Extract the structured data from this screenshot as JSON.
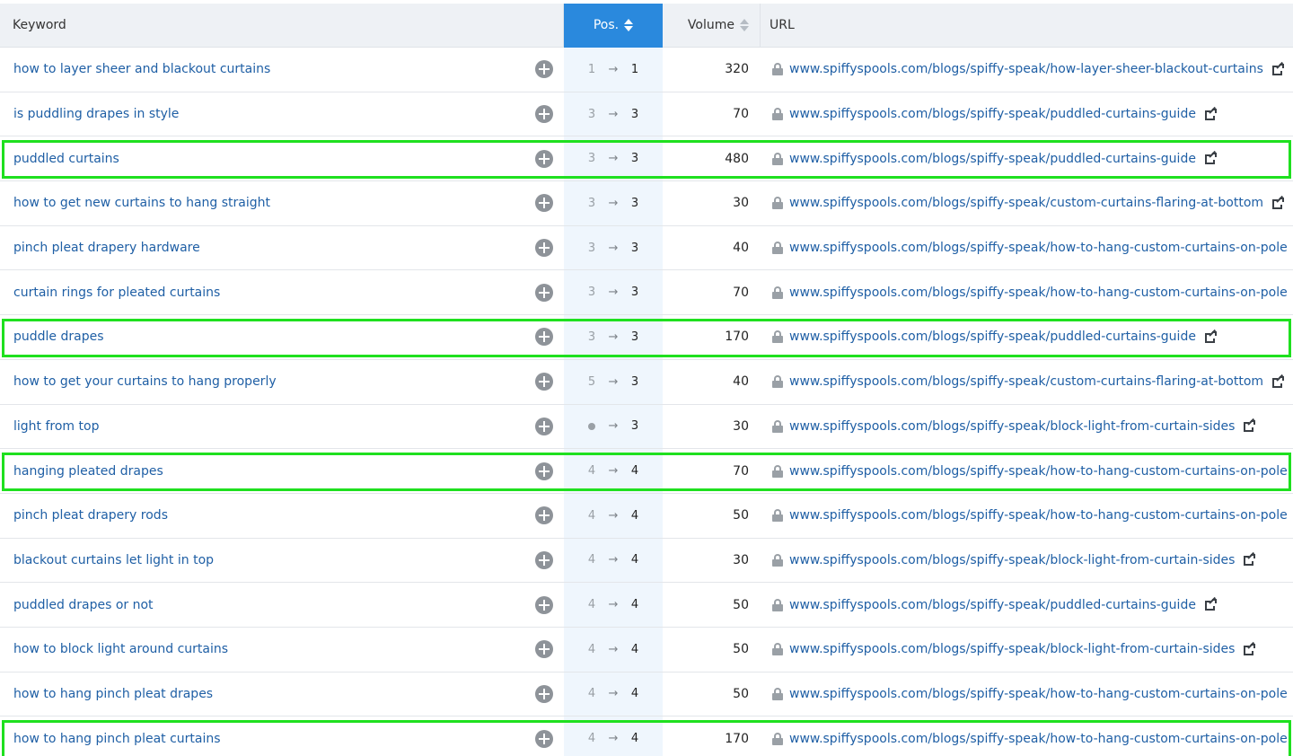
{
  "header": {
    "keyword": "Keyword",
    "pos": "Pos.",
    "volume": "Volume",
    "url": "URL"
  },
  "rows": [
    {
      "keyword": "how to layer sheer and blackout curtains",
      "prev": "1",
      "cur": "1",
      "volume": "320",
      "url": "www.spiffyspools.com/blogs/spiffy-speak/how-layer-sheer-blackout-curtains",
      "highlighted": false
    },
    {
      "keyword": "is puddling drapes in style",
      "prev": "3",
      "cur": "3",
      "volume": "70",
      "url": "www.spiffyspools.com/blogs/spiffy-speak/puddled-curtains-guide",
      "highlighted": false
    },
    {
      "keyword": "puddled curtains",
      "prev": "3",
      "cur": "3",
      "volume": "480",
      "url": "www.spiffyspools.com/blogs/spiffy-speak/puddled-curtains-guide",
      "highlighted": true
    },
    {
      "keyword": "how to get new curtains to hang straight",
      "prev": "3",
      "cur": "3",
      "volume": "30",
      "url": "www.spiffyspools.com/blogs/spiffy-speak/custom-curtains-flaring-at-bottom",
      "highlighted": false
    },
    {
      "keyword": "pinch pleat drapery hardware",
      "prev": "3",
      "cur": "3",
      "volume": "40",
      "url": "www.spiffyspools.com/blogs/spiffy-speak/how-to-hang-custom-curtains-on-pole",
      "highlighted": false
    },
    {
      "keyword": "curtain rings for pleated curtains",
      "prev": "3",
      "cur": "3",
      "volume": "70",
      "url": "www.spiffyspools.com/blogs/spiffy-speak/how-to-hang-custom-curtains-on-pole",
      "highlighted": false
    },
    {
      "keyword": "puddle drapes",
      "prev": "3",
      "cur": "3",
      "volume": "170",
      "url": "www.spiffyspools.com/blogs/spiffy-speak/puddled-curtains-guide",
      "highlighted": true
    },
    {
      "keyword": "how to get your curtains to hang properly",
      "prev": "5",
      "cur": "3",
      "volume": "40",
      "url": "www.spiffyspools.com/blogs/spiffy-speak/custom-curtains-flaring-at-bottom",
      "highlighted": false
    },
    {
      "keyword": "light from top",
      "prev": "",
      "cur": "3",
      "volume": "30",
      "url": "www.spiffyspools.com/blogs/spiffy-speak/block-light-from-curtain-sides",
      "highlighted": false
    },
    {
      "keyword": "hanging pleated drapes",
      "prev": "4",
      "cur": "4",
      "volume": "70",
      "url": "www.spiffyspools.com/blogs/spiffy-speak/how-to-hang-custom-curtains-on-pole",
      "highlighted": true
    },
    {
      "keyword": "pinch pleat drapery rods",
      "prev": "4",
      "cur": "4",
      "volume": "50",
      "url": "www.spiffyspools.com/blogs/spiffy-speak/how-to-hang-custom-curtains-on-pole",
      "highlighted": false
    },
    {
      "keyword": "blackout curtains let light in top",
      "prev": "4",
      "cur": "4",
      "volume": "30",
      "url": "www.spiffyspools.com/blogs/spiffy-speak/block-light-from-curtain-sides",
      "highlighted": false
    },
    {
      "keyword": "puddled drapes or not",
      "prev": "4",
      "cur": "4",
      "volume": "50",
      "url": "www.spiffyspools.com/blogs/spiffy-speak/puddled-curtains-guide",
      "highlighted": false
    },
    {
      "keyword": "how to block light around curtains",
      "prev": "4",
      "cur": "4",
      "volume": "50",
      "url": "www.spiffyspools.com/blogs/spiffy-speak/block-light-from-curtain-sides",
      "highlighted": false
    },
    {
      "keyword": "how to hang pinch pleat drapes",
      "prev": "4",
      "cur": "4",
      "volume": "50",
      "url": "www.spiffyspools.com/blogs/spiffy-speak/how-to-hang-custom-curtains-on-pole",
      "highlighted": false
    },
    {
      "keyword": "how to hang pinch pleat curtains",
      "prev": "4",
      "cur": "4",
      "volume": "170",
      "url": "www.spiffyspools.com/blogs/spiffy-speak/how-to-hang-custom-curtains-on-pole",
      "highlighted": true
    }
  ],
  "colors": {
    "link": "#1f5fa5",
    "active_header": "#2a89dd",
    "highlight_border": "#1fe01f"
  }
}
